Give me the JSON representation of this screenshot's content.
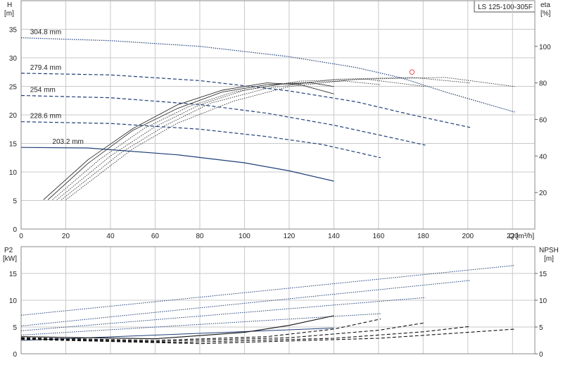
{
  "top_chart": {
    "title_box": "LS 125-100-305F",
    "left_axis": {
      "label": "H",
      "unit": "[m]"
    },
    "right_axis": {
      "label": "eta",
      "unit": "[%]"
    },
    "x_axis": {
      "label": "Q [m³/h]"
    }
  },
  "bottom_chart": {
    "left_axis": {
      "label": "P2",
      "unit": "[kW]"
    },
    "right_axis": {
      "label": "NPSH",
      "unit": "[m]"
    }
  },
  "colors": {
    "head_curve": "#1f3f78",
    "efficiency_curve": "#333333",
    "grid": "#c8c8c8",
    "operating_point": "#e05050"
  },
  "chart_data": [
    {
      "type": "line",
      "panel": "top",
      "xlim": [
        0,
        230
      ],
      "ylim": [
        0,
        40
      ],
      "y2lim": [
        0,
        125
      ],
      "x_ticks": [
        0,
        20,
        40,
        60,
        80,
        100,
        120,
        140,
        160,
        180,
        200,
        220
      ],
      "y_ticks": [
        0,
        5,
        10,
        15,
        20,
        25,
        30,
        35
      ],
      "y2_ticks": [
        20,
        40,
        60,
        80,
        100
      ],
      "grid": true,
      "head_series": [
        {
          "name": "304.8 mm",
          "style": "dotted",
          "points": [
            [
              0,
              33.5
            ],
            [
              40,
              33.0
            ],
            [
              80,
              32.0
            ],
            [
              120,
              30.2
            ],
            [
              150,
              28.3
            ],
            [
              170,
              26.5
            ],
            [
              190,
              24.0
            ],
            [
              221,
              20.5
            ]
          ]
        },
        {
          "name": "279.4 mm",
          "style": "dashed",
          "points": [
            [
              0,
              27.3
            ],
            [
              40,
              27.0
            ],
            [
              80,
              26.0
            ],
            [
              120,
              24.2
            ],
            [
              150,
              22.3
            ],
            [
              175,
              20.0
            ],
            [
              201,
              17.8
            ]
          ]
        },
        {
          "name": "254 mm",
          "style": "dashed",
          "points": [
            [
              0,
              23.4
            ],
            [
              40,
              23.0
            ],
            [
              80,
              21.8
            ],
            [
              110,
              20.3
            ],
            [
              140,
              18.2
            ],
            [
              160,
              16.5
            ],
            [
              181,
              14.7
            ]
          ]
        },
        {
          "name": "228.6 mm",
          "style": "dashed",
          "points": [
            [
              0,
              18.8
            ],
            [
              40,
              18.5
            ],
            [
              80,
              17.5
            ],
            [
              110,
              16.2
            ],
            [
              135,
              14.8
            ],
            [
              161,
              12.5
            ]
          ]
        },
        {
          "name": "203.2 mm",
          "style": "solid",
          "points": [
            [
              0,
              14.3
            ],
            [
              30,
              14.2
            ],
            [
              70,
              13.0
            ],
            [
              100,
              11.6
            ],
            [
              120,
              10.2
            ],
            [
              140,
              8.4
            ]
          ]
        }
      ],
      "efficiency_series": [
        {
          "style": "solid",
          "points": [
            [
              10,
              16
            ],
            [
              30,
              38
            ],
            [
              50,
              55
            ],
            [
              70,
              68
            ],
            [
              90,
              76
            ],
            [
              110,
              80
            ],
            [
              125,
              79
            ],
            [
              140,
              74
            ]
          ]
        },
        {
          "style": "solid",
          "points": [
            [
              12,
              16
            ],
            [
              30,
              36
            ],
            [
              50,
              54
            ],
            [
              70,
              66
            ],
            [
              90,
              75
            ],
            [
              110,
              79
            ],
            [
              130,
              80
            ],
            [
              140,
              78
            ]
          ]
        },
        {
          "style": "dotted",
          "points": [
            [
              14,
              16
            ],
            [
              35,
              38
            ],
            [
              55,
              55
            ],
            [
              75,
              67
            ],
            [
              95,
              75
            ],
            [
              120,
              80
            ],
            [
              145,
              81
            ],
            [
              161,
              79
            ]
          ]
        },
        {
          "style": "dotted",
          "points": [
            [
              16,
              16
            ],
            [
              40,
              40
            ],
            [
              60,
              56
            ],
            [
              80,
              68
            ],
            [
              100,
              76
            ],
            [
              125,
              81
            ],
            [
              155,
              82
            ],
            [
              181,
              78
            ]
          ]
        },
        {
          "style": "dotted",
          "points": [
            [
              18,
              16
            ],
            [
              45,
              42
            ],
            [
              65,
              57
            ],
            [
              85,
              69
            ],
            [
              110,
              77
            ],
            [
              140,
              82
            ],
            [
              175,
              83
            ],
            [
              201,
              80
            ]
          ]
        },
        {
          "style": "dotted",
          "points": [
            [
              20,
              16
            ],
            [
              50,
              44
            ],
            [
              70,
              58
            ],
            [
              95,
              70
            ],
            [
              120,
              78
            ],
            [
              150,
              82
            ],
            [
              190,
              83
            ],
            [
              221,
              78
            ]
          ]
        }
      ],
      "operating_point": {
        "q": 175,
        "h": 27.5
      }
    },
    {
      "type": "line",
      "panel": "bottom",
      "xlim": [
        0,
        230
      ],
      "ylim": [
        0,
        20
      ],
      "y2lim": [
        0,
        20
      ],
      "y_ticks": [
        0,
        5,
        10,
        15
      ],
      "y2_ticks": [
        0,
        5,
        10,
        15
      ],
      "grid": true,
      "power_series": [
        {
          "style": "dotted",
          "points": [
            [
              0,
              7.2
            ],
            [
              221,
              16.5
            ]
          ]
        },
        {
          "style": "dotted",
          "points": [
            [
              0,
              5.2
            ],
            [
              201,
              13.7
            ]
          ]
        },
        {
          "style": "dotted",
          "points": [
            [
              0,
              4.3
            ],
            [
              181,
              10.5
            ]
          ]
        },
        {
          "style": "dotted",
          "points": [
            [
              0,
              3.5
            ],
            [
              161,
              7.5
            ]
          ]
        },
        {
          "style": "solid",
          "points": [
            [
              0,
              2.5
            ],
            [
              140,
              4.8
            ]
          ]
        }
      ],
      "npsh_series": [
        {
          "style": "solid",
          "points": [
            [
              0,
              3.2
            ],
            [
              60,
              2.8
            ],
            [
              100,
              4.0
            ],
            [
              120,
              5.3
            ],
            [
              140,
              7.1
            ]
          ]
        },
        {
          "style": "dashed",
          "points": [
            [
              0,
              3.0
            ],
            [
              60,
              2.5
            ],
            [
              110,
              3.2
            ],
            [
              140,
              4.6
            ],
            [
              161,
              6.5
            ]
          ]
        },
        {
          "style": "dashed",
          "points": [
            [
              0,
              2.9
            ],
            [
              60,
              2.3
            ],
            [
              120,
              3.0
            ],
            [
              160,
              4.4
            ],
            [
              181,
              5.8
            ]
          ]
        },
        {
          "style": "dashed",
          "points": [
            [
              0,
              2.8
            ],
            [
              70,
              2.1
            ],
            [
              140,
              2.9
            ],
            [
              180,
              4.1
            ],
            [
              201,
              5.1
            ]
          ]
        },
        {
          "style": "dashed",
          "points": [
            [
              0,
              2.7
            ],
            [
              80,
              1.9
            ],
            [
              160,
              2.9
            ],
            [
              200,
              4.0
            ],
            [
              221,
              4.6
            ]
          ]
        }
      ]
    }
  ]
}
